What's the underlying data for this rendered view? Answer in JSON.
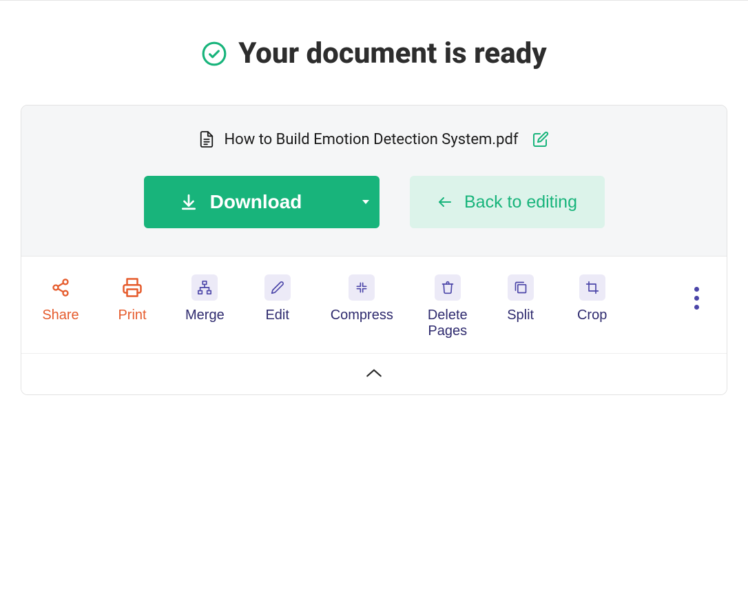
{
  "header": {
    "title": "Your document is ready"
  },
  "file": {
    "name": "How to Build Emotion Detection System.pdf"
  },
  "buttons": {
    "download": "Download",
    "back": "Back to editing"
  },
  "tools": {
    "share": "Share",
    "print": "Print",
    "merge": "Merge",
    "edit": "Edit",
    "compress": "Compress",
    "delete_pages": "Delete\nPages",
    "split": "Split",
    "crop": "Crop"
  }
}
